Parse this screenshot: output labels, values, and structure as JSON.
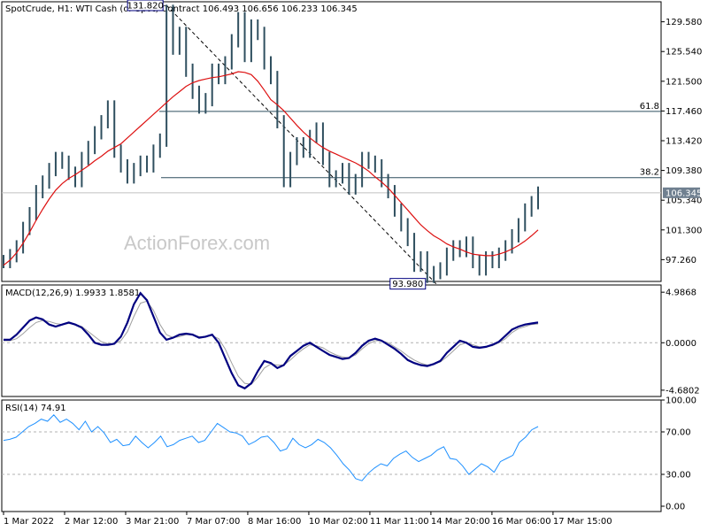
{
  "chart_data": [
    {
      "panel": "price",
      "type": "bar",
      "title": "SpotCrude, H1:  WTI Cash (or Spot) Contract  106.493 106.656 106.233 106.345",
      "ylim": [
        94.3,
        132.3
      ],
      "y_ticks": [
        "129.580",
        "125.540",
        "121.500",
        "117.460",
        "113.420",
        "109.380",
        "105.340",
        "101.300",
        "97.260"
      ],
      "current_price": "106.345",
      "watermark": "ActionForex.com",
      "annotations": {
        "high": {
          "label": "131.820",
          "value": 131.82
        },
        "low": {
          "label": "93.980",
          "value": 93.98
        }
      },
      "fib_levels": [
        {
          "label": "61.8",
          "value": 117.4
        },
        {
          "label": "38.2",
          "value": 108.4
        }
      ],
      "series": [
        {
          "kind": "ohlc-close",
          "values": [
            97.0,
            97.8,
            99.0,
            101.5,
            103.5,
            106.5,
            107.8,
            109.5,
            111.0,
            110.5,
            109.0,
            108.0,
            111.0,
            112.5,
            114.5,
            116.0,
            118.0,
            112.0,
            110.0,
            108.5,
            109.5,
            110.5,
            110.0,
            112.0,
            113.5,
            131.0,
            126.0,
            128.0,
            123.0,
            120.0,
            118.0,
            119.0,
            123.0,
            122.0,
            124.0,
            127.0,
            130.0,
            125.0,
            129.0,
            128.0,
            124.0,
            122.0,
            116.0,
            108.0,
            111.0,
            113.0,
            112.0,
            114.0,
            115.0,
            111.0,
            108.0,
            108.5,
            109.5,
            107.0,
            108.0,
            111.0,
            110.5,
            110.0,
            108.0,
            106.5,
            104.0,
            102.0,
            100.0,
            96.5,
            97.5,
            95.0,
            95.5,
            96.0,
            98.0,
            99.0,
            98.5,
            99.5,
            97.0,
            96.0,
            97.5,
            97.0,
            98.0,
            99.0,
            100.5,
            102.0,
            104.0,
            105.0,
            106.3
          ]
        },
        {
          "kind": "moving-average",
          "values": [
            96.5,
            97.2,
            98.2,
            99.5,
            101.0,
            102.6,
            104.1,
            105.5,
            106.7,
            107.6,
            108.3,
            108.8,
            109.4,
            110.0,
            110.7,
            111.3,
            112.0,
            112.5,
            113.0,
            113.8,
            114.6,
            115.4,
            116.2,
            117.0,
            117.8,
            118.6,
            119.4,
            120.1,
            120.8,
            121.3,
            121.6,
            121.8,
            122.0,
            122.1,
            122.3,
            122.5,
            122.8,
            122.7,
            122.4,
            121.5,
            120.3,
            119.0,
            118.3,
            117.5,
            116.5,
            115.5,
            114.6,
            113.8,
            113.1,
            112.5,
            112.0,
            111.6,
            111.2,
            110.8,
            110.4,
            109.9,
            109.3,
            108.5,
            107.8,
            107.0,
            106.0,
            105.0,
            104.0,
            103.0,
            102.0,
            101.2,
            100.5,
            100.0,
            99.4,
            99.0,
            98.7,
            98.3,
            98.0,
            97.9,
            97.8,
            97.8,
            98.0,
            98.3,
            98.7,
            99.2,
            99.8,
            100.5,
            101.3
          ]
        }
      ]
    },
    {
      "panel": "macd",
      "type": "line",
      "title": "MACD(12,26,9) 1.9933 1.8581",
      "ylim": [
        -5.3,
        5.7
      ],
      "y_ticks": [
        "4.9868",
        "0.0000",
        "-4.6802"
      ],
      "series": [
        {
          "kind": "macd",
          "values": [
            0.3,
            0.3,
            0.8,
            1.5,
            2.2,
            2.5,
            2.3,
            1.8,
            1.6,
            1.8,
            2.0,
            1.8,
            1.5,
            0.8,
            0.0,
            -0.2,
            -0.2,
            -0.1,
            0.6,
            2.0,
            3.8,
            4.9,
            4.2,
            2.6,
            1.0,
            0.3,
            0.5,
            0.8,
            0.9,
            0.8,
            0.5,
            0.6,
            0.8,
            0.0,
            -1.5,
            -3.0,
            -4.2,
            -4.5,
            -4.0,
            -2.8,
            -1.8,
            -2.0,
            -2.5,
            -2.2,
            -1.3,
            -0.8,
            -0.3,
            0.0,
            -0.4,
            -0.8,
            -1.2,
            -1.4,
            -1.6,
            -1.5,
            -1.0,
            -0.3,
            0.2,
            0.4,
            0.2,
            -0.2,
            -0.6,
            -1.1,
            -1.7,
            -2.0,
            -2.2,
            -2.3,
            -2.1,
            -1.8,
            -1.0,
            -0.4,
            0.2,
            0.0,
            -0.4,
            -0.5,
            -0.4,
            -0.2,
            0.1,
            0.7,
            1.3,
            1.6,
            1.8,
            1.9,
            2.0
          ]
        },
        {
          "kind": "signal",
          "values": [
            0.2,
            0.2,
            0.4,
            0.9,
            1.5,
            2.0,
            2.2,
            2.1,
            1.9,
            1.8,
            1.9,
            1.8,
            1.6,
            1.1,
            0.6,
            0.1,
            -0.1,
            -0.1,
            0.2,
            1.1,
            2.6,
            3.9,
            4.1,
            3.2,
            1.8,
            0.8,
            0.5,
            0.6,
            0.8,
            0.8,
            0.6,
            0.6,
            0.7,
            0.4,
            -0.6,
            -2.0,
            -3.3,
            -4.0,
            -4.1,
            -3.4,
            -2.5,
            -2.1,
            -2.2,
            -2.2,
            -1.7,
            -1.1,
            -0.6,
            -0.2,
            -0.3,
            -0.5,
            -0.9,
            -1.2,
            -1.4,
            -1.5,
            -1.2,
            -0.6,
            -0.1,
            0.2,
            0.2,
            0.0,
            -0.4,
            -0.8,
            -1.3,
            -1.7,
            -2.0,
            -2.2,
            -2.1,
            -1.9,
            -1.4,
            -0.8,
            -0.2,
            0.0,
            -0.2,
            -0.4,
            -0.4,
            -0.3,
            0.0,
            0.4,
            1.0,
            1.4,
            1.6,
            1.8,
            1.86
          ]
        }
      ]
    },
    {
      "panel": "rsi",
      "type": "line",
      "title": "RSI(14) 74.91",
      "ylim": [
        -5,
        100
      ],
      "y_ticks": [
        "100.00",
        "70.00",
        "30.00",
        "0.00"
      ],
      "series": [
        {
          "kind": "rsi",
          "values": [
            62,
            63,
            65,
            70,
            75,
            78,
            82,
            80,
            86,
            79,
            82,
            78,
            72,
            80,
            70,
            75,
            69,
            60,
            63,
            57,
            58,
            66,
            60,
            55,
            60,
            66,
            56,
            58,
            62,
            64,
            66,
            60,
            62,
            70,
            78,
            74,
            70,
            69,
            66,
            58,
            61,
            65,
            66,
            60,
            52,
            54,
            64,
            58,
            55,
            58,
            63,
            60,
            55,
            48,
            40,
            34,
            26,
            24,
            31,
            36,
            40,
            38,
            45,
            49,
            52,
            46,
            42,
            45,
            48,
            53,
            56,
            45,
            44,
            38,
            30,
            35,
            40,
            37,
            32,
            42,
            45,
            48,
            60,
            65,
            72,
            75
          ]
        }
      ]
    }
  ],
  "x_labels": [
    "1 Mar 2022",
    "2 Mar 12:00",
    "3 Mar 21:00",
    "7 Mar 07:00",
    "8 Mar 16:00",
    "10 Mar 02:00",
    "11 Mar 11:00",
    "14 Mar 20:00",
    "16 Mar 06:00",
    "17 Mar 15:00"
  ],
  "colors": {
    "bars": "#2f4f5f",
    "ma": "#dd1111",
    "macd": "#000080",
    "signal": "#a0a0a0",
    "rsi": "#1e90ff",
    "price_tag": "#708090",
    "fib": "#2f4f5f"
  }
}
